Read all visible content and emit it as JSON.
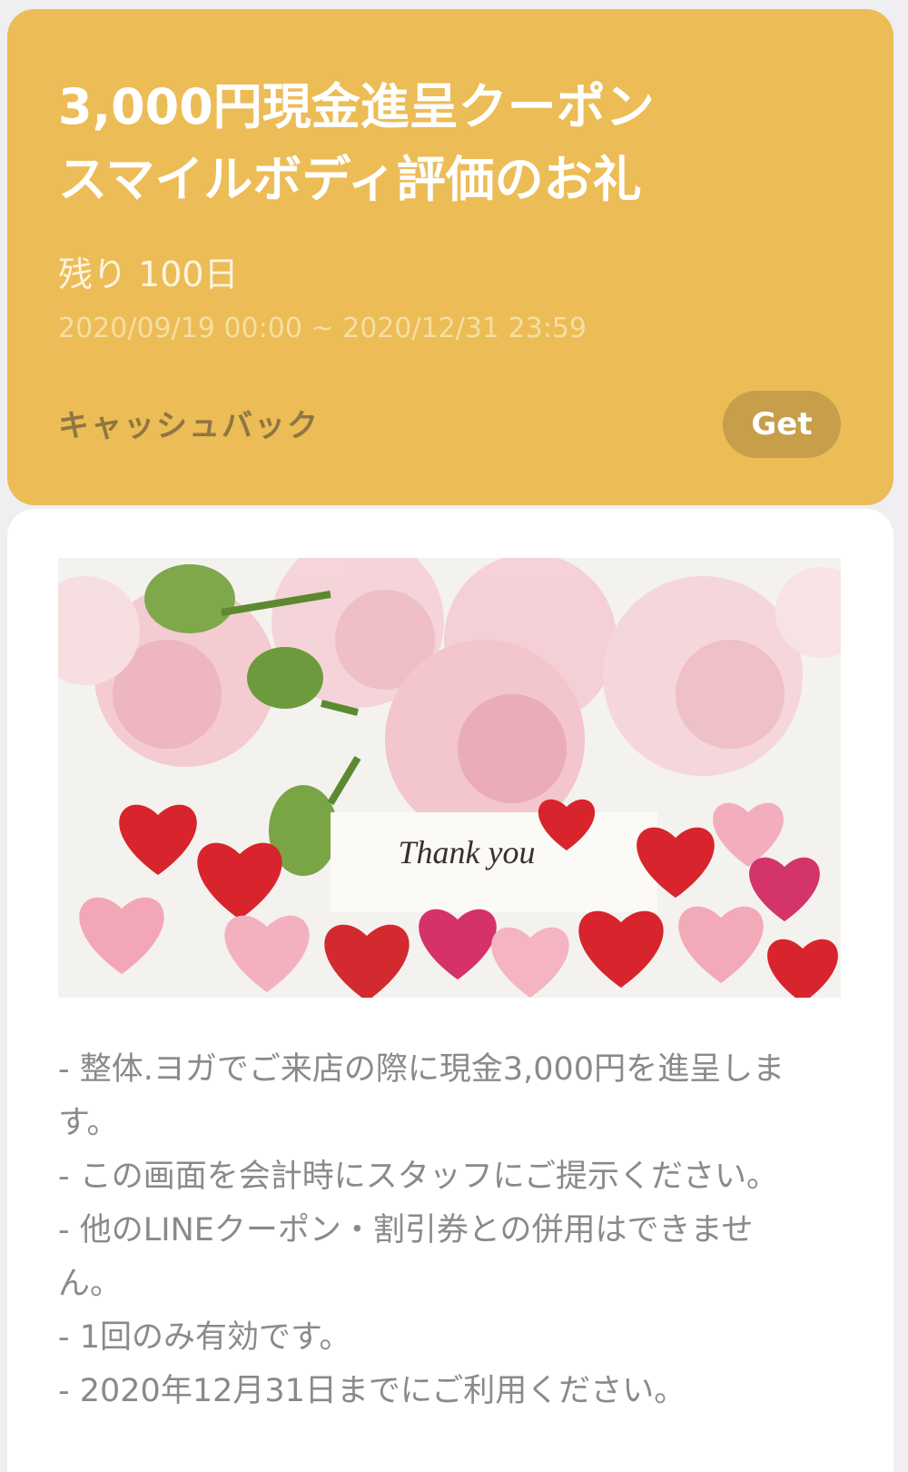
{
  "header": {
    "title_line1": "3,000円現金進呈クーポン",
    "title_line2": "スマイルボディ評価のお礼",
    "remaining": "残り 100日",
    "period": "2020/09/19 00:00 ~ 2020/12/31 23:59",
    "type_label": "キャッシュバック",
    "get_label": "Get"
  },
  "image": {
    "caption": "Thank you"
  },
  "description": {
    "lines": [
      "- 整体.ヨガでご来店の際に現金3,000円を進呈しま",
      "す。",
      "- この画面を会計時にスタッフにご提示ください。",
      "- 他のLINEクーポン・割引券との併用はできませ",
      "ん。",
      "- 1回のみ有効です。",
      "- 2020年12月31日までにご利用ください。"
    ]
  },
  "colors": {
    "header_bg": "#ecbc56",
    "get_button_bg": "#c79e4a",
    "page_bg": "#efeff1"
  }
}
